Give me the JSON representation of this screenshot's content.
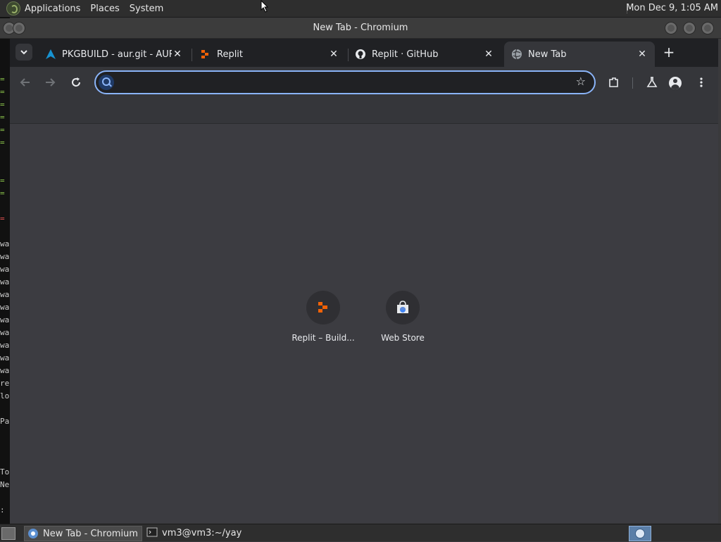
{
  "desktop": {
    "menu": [
      "Applications",
      "Places",
      "System"
    ],
    "clock": "Mon Dec 9, 1:05 AM"
  },
  "window": {
    "title": "New Tab - Chromium"
  },
  "browser": {
    "tabs": [
      {
        "label": "PKGBUILD - aur.git - AUR",
        "icon": "arch-logo-icon",
        "active": false
      },
      {
        "label": "Replit",
        "icon": "replit-icon",
        "active": false
      },
      {
        "label": "Replit · GitHub",
        "icon": "github-icon",
        "active": false
      },
      {
        "label": "New Tab",
        "icon": "globe-icon",
        "active": true
      }
    ],
    "new_tab_symbol": "+",
    "omnibox": {
      "value": "",
      "placeholder": ""
    },
    "shortcuts": [
      {
        "label": "Replit – Build...",
        "icon": "replit-icon"
      },
      {
        "label": "Web Store",
        "icon": "web-store-icon"
      }
    ]
  },
  "taskbar": {
    "tasks": [
      {
        "label": "New Tab - Chromium",
        "icon": "chromium-icon",
        "active": true
      },
      {
        "label": "vm3@vm3:~/yay",
        "icon": "terminal-icon",
        "active": false
      }
    ]
  },
  "terminal_fragments": [
    "=",
    "=",
    "=",
    "=",
    "=",
    "=",
    "=",
    "=",
    "=",
    "wa",
    "wa",
    "wa",
    "wa",
    "wa",
    "wa",
    "wa",
    "wa",
    "wa",
    "wa",
    "wa",
    "re",
    "lo",
    "Pa",
    "To",
    "Ne",
    ":"
  ]
}
